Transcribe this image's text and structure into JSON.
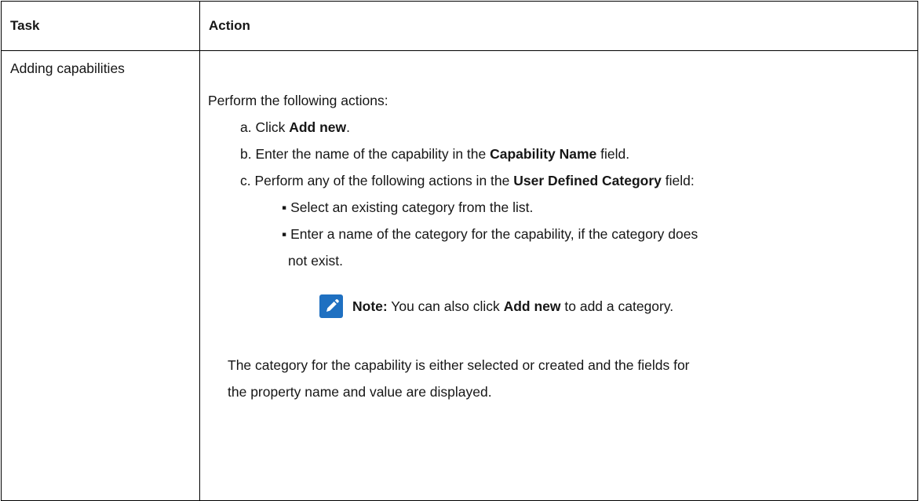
{
  "table": {
    "headers": {
      "task": "Task",
      "action": "Action"
    },
    "row": {
      "task": "Adding capabilities",
      "intro": "Perform the following actions:",
      "step_a": {
        "prefix": "a. Click ",
        "bold": "Add new",
        "suffix": "."
      },
      "step_b": {
        "prefix": "b. Enter the name of the capability in the ",
        "bold": "Capability Name",
        "suffix": " field."
      },
      "step_c": {
        "prefix": "c. Perform any of the following actions in the ",
        "bold": "User Defined Category",
        "suffix": " field:"
      },
      "bullet_1": "▪ Select an existing category from the list.",
      "bullet_2_line1": "▪ Enter a name of the category for the capability, if the category does",
      "bullet_2_line2": "not exist.",
      "note": {
        "icon": "pencil-note-icon",
        "label": "Note:",
        "text_before": " You can also click ",
        "bold": "Add new",
        "text_after": " to add a category."
      },
      "result_line1": "The category for the capability is either selected or created and the fields for",
      "result_line2": "the property name and value are displayed."
    }
  }
}
